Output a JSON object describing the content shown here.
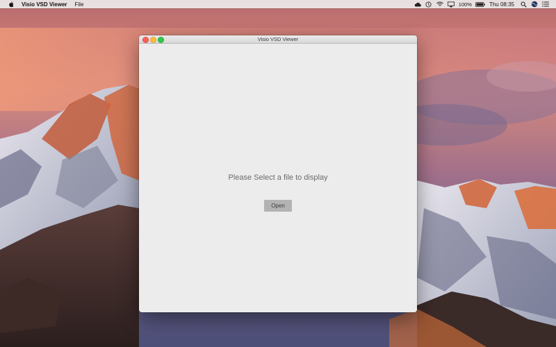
{
  "menubar": {
    "app_name": "Visio VSD Viewer",
    "menus": [
      "File"
    ],
    "status_icons": [
      "cloud-icon",
      "clock-history-icon",
      "wifi-icon",
      "airplay-icon"
    ],
    "battery_percent": "100%",
    "day_time": "Thu 08:35",
    "right_icons": [
      "search-icon",
      "siri-icon",
      "notification-list-icon"
    ]
  },
  "window": {
    "title": "Visio VSD Viewer",
    "prompt": "Please Select a file to display",
    "open_button": "Open"
  },
  "colors": {
    "window_bg": "#ececec",
    "button_bg": "#b3b3b3",
    "traffic_close": "#fc605b",
    "traffic_minimize": "#fdbc40",
    "traffic_zoom": "#34c84a"
  }
}
